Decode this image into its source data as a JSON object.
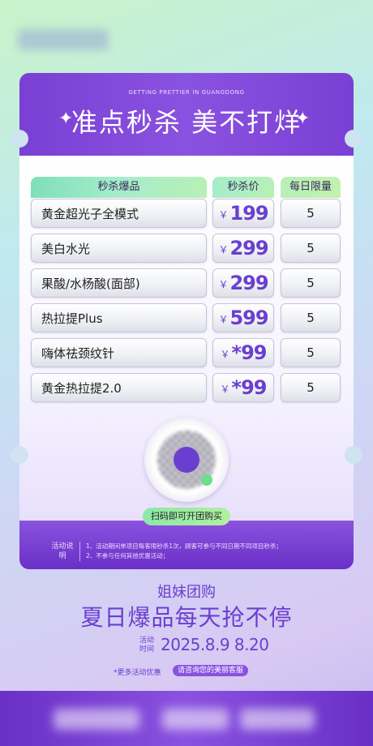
{
  "poster": {
    "subtitle_en": "GETTING PRETTIER IN GUANGDONG",
    "title": "准点秒杀 美不打烊",
    "sparkle_icon": "four-point-star-icon"
  },
  "table": {
    "headers": {
      "name": "秒杀爆品",
      "price": "秒杀价",
      "limit": "每日限量"
    },
    "currency": "￥",
    "rows": [
      {
        "name": "黄金超光子全模式",
        "price": "199",
        "limit": "5"
      },
      {
        "name": "美白水光",
        "price": "299",
        "limit": "5"
      },
      {
        "name": "果酸/水杨酸(面部)",
        "price": "299",
        "limit": "5"
      },
      {
        "name": "热拉提Plus",
        "price": "599",
        "limit": "5"
      },
      {
        "name": "嗨体祛颈纹针",
        "price": "*99",
        "limit": "5"
      },
      {
        "name": "黄金热拉提2.0",
        "price": "*99",
        "limit": "5"
      }
    ]
  },
  "qr": {
    "button": "扫码即可开团购买"
  },
  "rules": {
    "label": "活动说明",
    "items": [
      "1、活动期间单项目每客限秒杀1次，顾客可参与不同日期不同项目秒杀；",
      "2、不参与任何其他优惠活动；"
    ]
  },
  "footer": {
    "sub1": "姐妹团购",
    "sub2": "夏日爆品每天抢不停",
    "date_label": "活动时间",
    "date": "2025.8.9 8.20",
    "more": "*更多活动优惠",
    "consult": "请咨询您的美丽客服"
  },
  "colors": {
    "primary": "#7a3fd4",
    "accent_green": "#9ce9b8",
    "price": "#6a3fd0"
  }
}
